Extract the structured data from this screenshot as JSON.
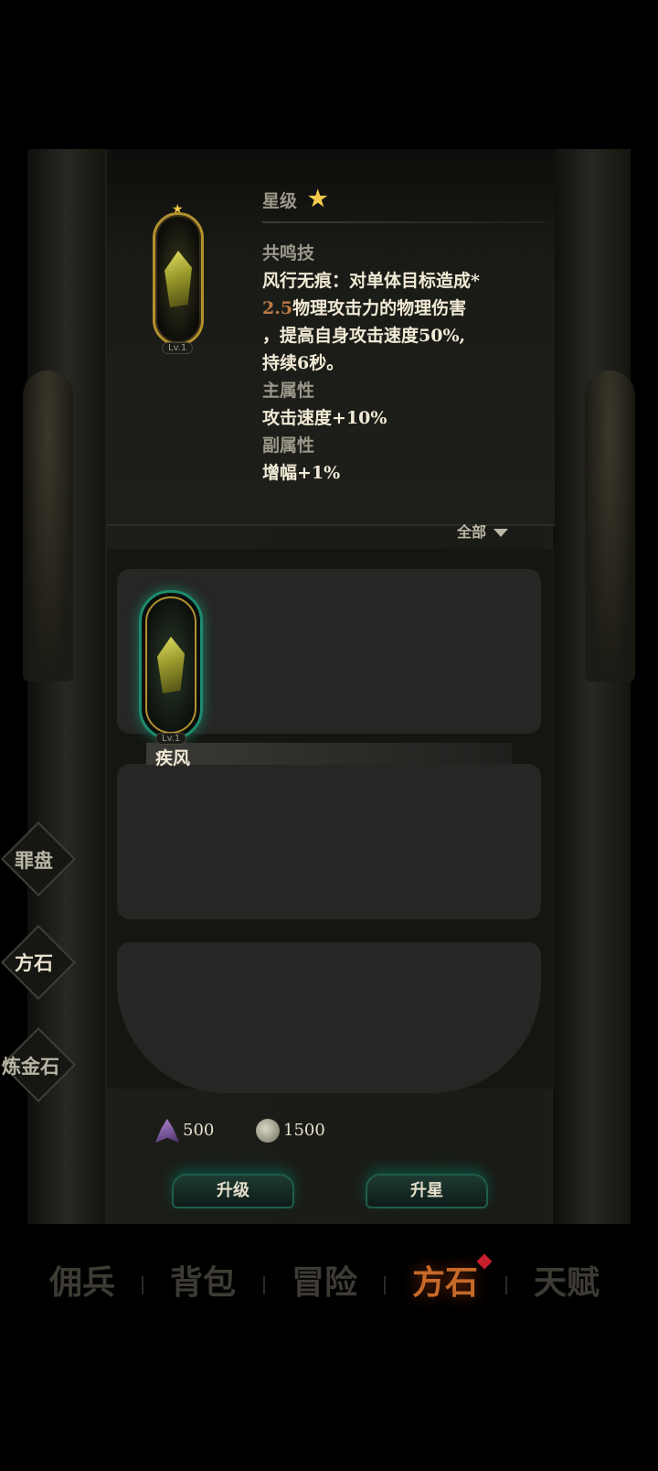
{
  "detail": {
    "star_label": "星级",
    "resonance_heading": "共鸣技",
    "skill_line1": "风行无痕：对单体目标造成*",
    "skill_multiplier": "2.5",
    "skill_line2_rest": "物理攻击力的物理伤害",
    "skill_line3": "，提高自身攻击速度50%,",
    "skill_line4": "持续6秒。",
    "main_attr_heading": "主属性",
    "main_attr_value": "攻击速度+10%",
    "sub_attr_heading": "副属性",
    "sub_attr_value": "增幅+1%",
    "item_level": "Lv.1"
  },
  "filter": {
    "label": "全部"
  },
  "items": [
    {
      "name": "疾风",
      "level": "Lv.1"
    }
  ],
  "side_menu": [
    "罪盘",
    "方石",
    "炼金石"
  ],
  "resources": [
    {
      "icon": "crystal-shard-icon",
      "amount": "500"
    },
    {
      "icon": "coin-icon",
      "amount": "1500"
    }
  ],
  "actions": {
    "upgrade": "升级",
    "star_up": "升星"
  },
  "bottom_tabs": [
    {
      "label": "佣兵",
      "active": false
    },
    {
      "label": "背包",
      "active": false
    },
    {
      "label": "冒险",
      "active": false
    },
    {
      "label": "方石",
      "active": true
    },
    {
      "label": "天赋",
      "active": false
    }
  ],
  "colors": {
    "accent_gold": "#b2902e",
    "accent_teal": "#1d8b6f",
    "active_tab": "#c76a2a",
    "notify": "#c8202c"
  }
}
